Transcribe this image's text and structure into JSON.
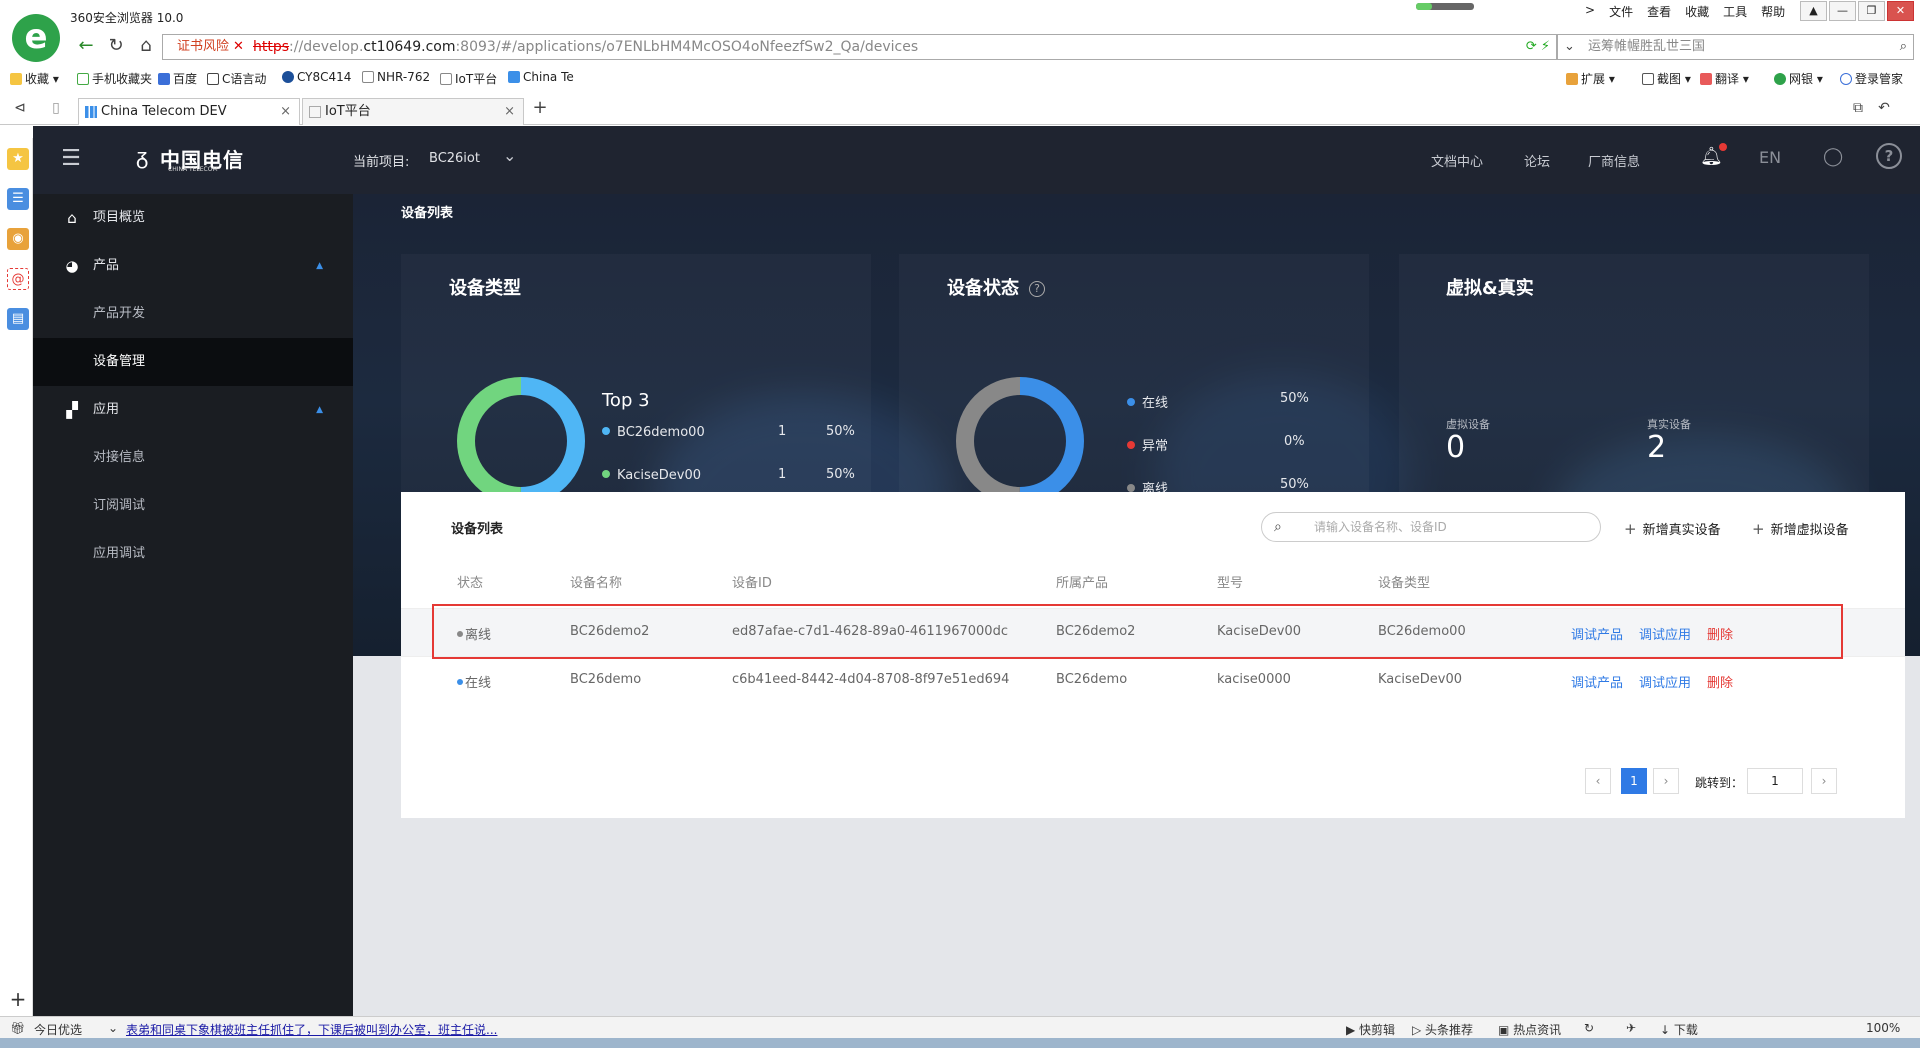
{
  "browser": {
    "title": "360安全浏览器 10.0",
    "top_menus": [
      "文件",
      "查看",
      "收藏",
      "工具",
      "帮助"
    ],
    "cert_warning": "证书风险",
    "url_scheme": "https",
    "url_pre": "://develop.",
    "url_host": "ct10649.com",
    "url_rest": ":8093/#/applications/o7ENLbHM4McOSO4oNfeezfSw2_Qa/devices",
    "search_text": "运筹帷幄胜乱世三国",
    "bookmarks": [
      "收藏",
      "手机收藏夹",
      "百度",
      "C语言动",
      "CY8C414",
      "NHR-762",
      "IoT平台",
      "China Te"
    ],
    "bookmark_right": [
      "扩展",
      "截图",
      "翻译",
      "网银",
      "登录管家"
    ],
    "tabs": [
      {
        "label": "China Telecom DEV",
        "active": true
      },
      {
        "label": "IoT平台",
        "active": false
      }
    ]
  },
  "header": {
    "brand": "中国电信",
    "brand_en": "CHINA TELECOM",
    "project_label": "当前项目:",
    "project_name": "BC26iot",
    "links": [
      "文档中心",
      "论坛",
      "厂商信息"
    ],
    "lang": "EN"
  },
  "sidebar": {
    "items": [
      {
        "label": "项目概览",
        "icon": "home-icon"
      },
      {
        "label": "产品",
        "icon": "product-icon"
      },
      {
        "label": "产品开发"
      },
      {
        "label": "设备管理"
      },
      {
        "label": "应用",
        "icon": "apps-icon"
      },
      {
        "label": "对接信息"
      },
      {
        "label": "订阅调试"
      },
      {
        "label": "应用调试"
      }
    ]
  },
  "hero": {
    "page_title": "设备列表",
    "device_type": {
      "title": "设备类型",
      "top_label": "Top 3",
      "rows": [
        {
          "name": "BC26demo00",
          "count": "1",
          "pct": "50%",
          "color": "#4fb6f5"
        },
        {
          "name": "KaciseDev00",
          "count": "1",
          "pct": "50%",
          "color": "#71d57f"
        }
      ]
    },
    "device_status": {
      "title": "设备状态",
      "rows": [
        {
          "name": "在线",
          "pct": "50%",
          "color": "#3b8fe8"
        },
        {
          "name": "异常",
          "pct": "0%",
          "color": "#e53935"
        },
        {
          "name": "离线",
          "pct": "50%",
          "color": "#888888"
        }
      ]
    },
    "virtual_real": {
      "title": "虚拟&真实",
      "virtual_label": "虚拟设备",
      "virtual_count": "0",
      "real_label": "真实设备",
      "real_count": "2"
    }
  },
  "chart_data": [
    {
      "type": "pie",
      "title": "设备类型",
      "categories": [
        "BC26demo00",
        "KaciseDev00"
      ],
      "values": [
        1,
        1
      ],
      "colors": [
        "#4fb6f5",
        "#71d57f"
      ]
    },
    {
      "type": "pie",
      "title": "设备状态",
      "categories": [
        "在线",
        "异常",
        "离线"
      ],
      "values": [
        50,
        0,
        50
      ],
      "colors": [
        "#3b8fe8",
        "#e53935",
        "#888888"
      ]
    }
  ],
  "list": {
    "title": "设备列表",
    "search_placeholder": "请输入设备名称、设备ID",
    "add_real": "新增真实设备",
    "add_virtual": "新增虚拟设备",
    "columns": [
      "状态",
      "设备名称",
      "设备ID",
      "所属产品",
      "型号",
      "设备类型"
    ],
    "rows": [
      {
        "status": "离线",
        "status_color": "#888888",
        "name": "BC26demo2",
        "id": "ed87afae-c7d1-4628-89a0-4611967000dc",
        "product": "BC26demo2",
        "model": "KaciseDev00",
        "type": "BC26demo00"
      },
      {
        "status": "在线",
        "status_color": "#3b8fe8",
        "name": "BC26demo",
        "id": "c6b41eed-8442-4d04-8708-8f97e51ed694",
        "product": "BC26demo",
        "model": "kacise0000",
        "type": "KaciseDev00"
      }
    ],
    "actions": [
      "调试产品",
      "调试应用",
      "删除"
    ],
    "pager": {
      "current": "1",
      "jump_label": "跳转到：",
      "jump_value": "1"
    }
  },
  "statusbar": {
    "today": "今日优选",
    "news": "表弟和同桌下象棋被班主任抓住了，下课后被叫到办公室，班主任说...",
    "right": [
      "快剪辑",
      "头条推荐",
      "热点资讯",
      "下载"
    ],
    "zoom": "100%"
  }
}
